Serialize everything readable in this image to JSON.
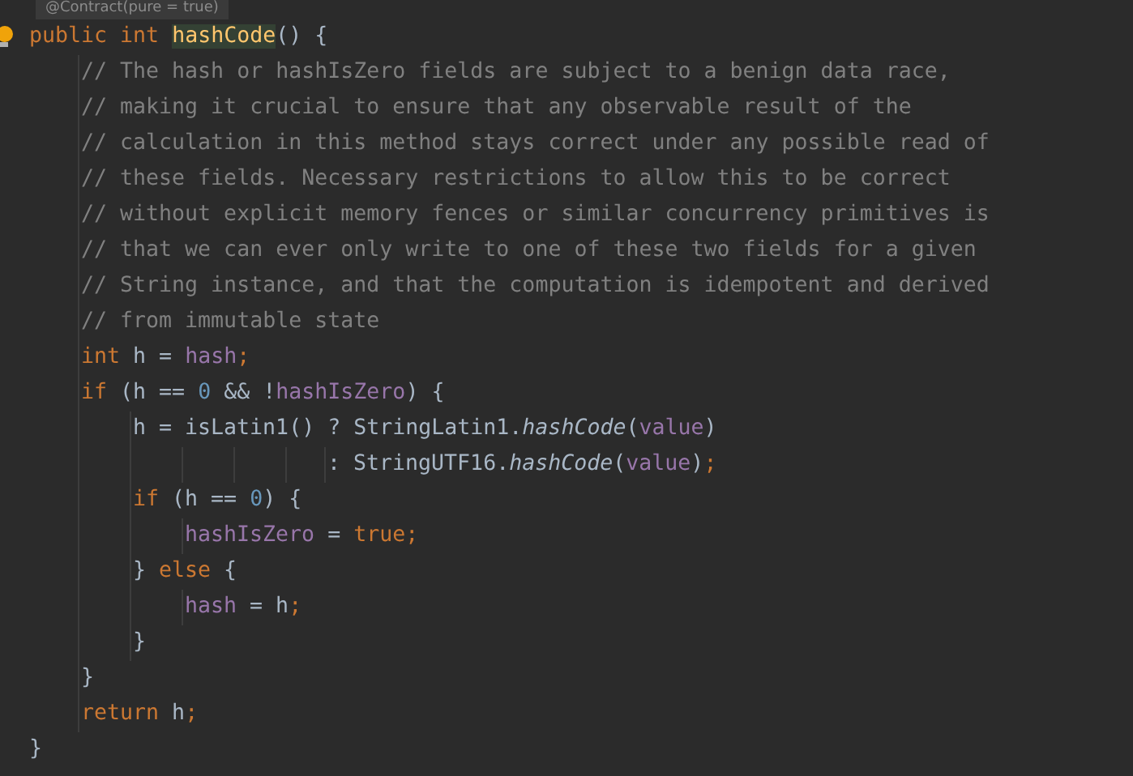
{
  "hint": "@Contract(pure = true)",
  "lines": [
    {
      "tokens": [
        {
          "kind": "keyword",
          "text": "public int "
        },
        {
          "kind": "declaration",
          "text": "hashCode"
        },
        {
          "kind": "plain",
          "text": "() {"
        }
      ]
    },
    {
      "tokens": [
        {
          "kind": "comment",
          "text": "    // The hash or hashIsZero fields are subject to a benign data race,"
        }
      ]
    },
    {
      "tokens": [
        {
          "kind": "comment",
          "text": "    // making it crucial to ensure that any observable result of the"
        }
      ]
    },
    {
      "tokens": [
        {
          "kind": "comment",
          "text": "    // calculation in this method stays correct under any possible read of"
        }
      ]
    },
    {
      "tokens": [
        {
          "kind": "comment",
          "text": "    // these fields. Necessary restrictions to allow this to be correct"
        }
      ]
    },
    {
      "tokens": [
        {
          "kind": "comment",
          "text": "    // without explicit memory fences or similar concurrency primitives is"
        }
      ]
    },
    {
      "tokens": [
        {
          "kind": "comment",
          "text": "    // that we can ever only write to one of these two fields for a given"
        }
      ]
    },
    {
      "tokens": [
        {
          "kind": "comment",
          "text": "    // String instance, and that the computation is idempotent and derived"
        }
      ]
    },
    {
      "tokens": [
        {
          "kind": "comment",
          "text": "    // from immutable state"
        }
      ]
    },
    {
      "tokens": [
        {
          "kind": "keyword",
          "text": "    int "
        },
        {
          "kind": "plain",
          "text": "h = "
        },
        {
          "kind": "field",
          "text": "hash"
        },
        {
          "kind": "keyword",
          "text": ";"
        }
      ]
    },
    {
      "tokens": [
        {
          "kind": "keyword",
          "text": "    if "
        },
        {
          "kind": "plain",
          "text": "(h == "
        },
        {
          "kind": "number",
          "text": "0"
        },
        {
          "kind": "plain",
          "text": " && !"
        },
        {
          "kind": "field",
          "text": "hashIsZero"
        },
        {
          "kind": "plain",
          "text": ") {"
        }
      ]
    },
    {
      "tokens": [
        {
          "kind": "plain",
          "text": "        h = isLatin1() ? StringLatin1."
        },
        {
          "kind": "static",
          "text": "hashCode"
        },
        {
          "kind": "plain",
          "text": "("
        },
        {
          "kind": "field",
          "text": "value"
        },
        {
          "kind": "plain",
          "text": ")"
        }
      ]
    },
    {
      "tokens": [
        {
          "kind": "plain",
          "text": "                       : StringUTF16."
        },
        {
          "kind": "static",
          "text": "hashCode"
        },
        {
          "kind": "plain",
          "text": "("
        },
        {
          "kind": "field",
          "text": "value"
        },
        {
          "kind": "plain",
          "text": ")"
        },
        {
          "kind": "keyword",
          "text": ";"
        }
      ]
    },
    {
      "tokens": [
        {
          "kind": "keyword",
          "text": "        if "
        },
        {
          "kind": "plain",
          "text": "(h == "
        },
        {
          "kind": "number",
          "text": "0"
        },
        {
          "kind": "plain",
          "text": ") {"
        }
      ]
    },
    {
      "tokens": [
        {
          "kind": "field",
          "text": "            hashIsZero"
        },
        {
          "kind": "plain",
          "text": " = "
        },
        {
          "kind": "keyword",
          "text": "true;"
        }
      ]
    },
    {
      "tokens": [
        {
          "kind": "plain",
          "text": "        } "
        },
        {
          "kind": "keyword",
          "text": "else "
        },
        {
          "kind": "plain",
          "text": "{"
        }
      ]
    },
    {
      "tokens": [
        {
          "kind": "field",
          "text": "            hash"
        },
        {
          "kind": "plain",
          "text": " = h"
        },
        {
          "kind": "keyword",
          "text": ";"
        }
      ]
    },
    {
      "tokens": [
        {
          "kind": "plain",
          "text": "        }"
        }
      ]
    },
    {
      "tokens": [
        {
          "kind": "plain",
          "text": "    }"
        }
      ]
    },
    {
      "tokens": [
        {
          "kind": "keyword",
          "text": "    return "
        },
        {
          "kind": "plain",
          "text": "h"
        },
        {
          "kind": "keyword",
          "text": ";"
        }
      ]
    },
    {
      "tokens": [
        {
          "kind": "plain",
          "text": "}"
        }
      ]
    }
  ]
}
